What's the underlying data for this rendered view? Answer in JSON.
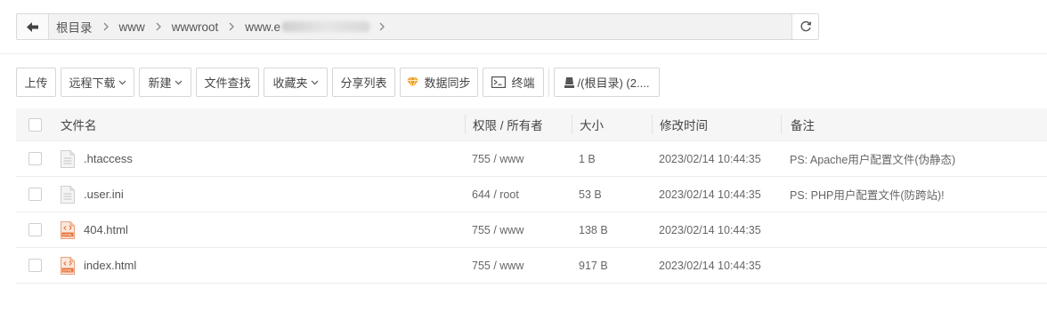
{
  "breadcrumb": {
    "items": [
      "根目录",
      "www",
      "wwwroot",
      "www.e"
    ]
  },
  "toolbar": {
    "upload": "上传",
    "remote_download": "远程下载",
    "new": "新建",
    "file_search": "文件查找",
    "favorites": "收藏夹",
    "share_list": "分享列表",
    "data_sync": "数据同步",
    "terminal": "终端",
    "disk": "/(根目录) (2...."
  },
  "table": {
    "headers": {
      "name": "文件名",
      "perm": "权限 / 所有者",
      "size": "大小",
      "mtime": "修改时间",
      "note": "备注"
    },
    "rows": [
      {
        "name": ".htaccess",
        "perm": "755 / www",
        "size": "1 B",
        "mtime": "2023/02/14 10:44:35",
        "note": "PS: Apache用户配置文件(伪静态)",
        "icon": "text-file-icon"
      },
      {
        "name": ".user.ini",
        "perm": "644 / root",
        "size": "53 B",
        "mtime": "2023/02/14 10:44:35",
        "note": "PS: PHP用户配置文件(防跨站)!",
        "icon": "text-file-icon"
      },
      {
        "name": "404.html",
        "perm": "755 / www",
        "size": "138 B",
        "mtime": "2023/02/14 10:44:35",
        "note": "",
        "icon": "html-file-icon"
      },
      {
        "name": "index.html",
        "perm": "755 / www",
        "size": "917 B",
        "mtime": "2023/02/14 10:44:35",
        "note": "",
        "icon": "html-file-icon"
      }
    ]
  },
  "colors": {
    "sync_icon": "#f0a020",
    "html_icon": "#e8743b"
  }
}
